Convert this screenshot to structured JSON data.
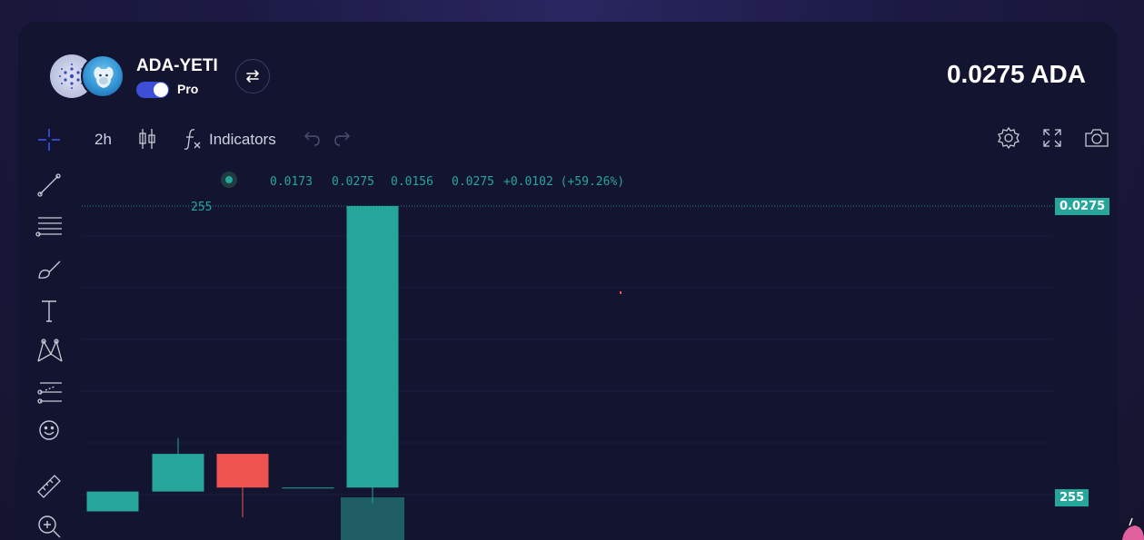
{
  "header": {
    "pair_name": "ADA-YETI",
    "pro_label": "Pro",
    "price": "0.0275 ADA"
  },
  "toolbar": {
    "interval": "2h",
    "indicators_label": "Indicators"
  },
  "legend": {
    "open": "0.0173",
    "high": "0.0275",
    "low": "0.0156",
    "close": "0.0275",
    "change": "+0.0102 (+59.26%)",
    "volume": "255"
  },
  "axis_tags": {
    "price_tag": "0.0275",
    "volume_tag": "255"
  },
  "colors": {
    "up": "#26a69a",
    "down": "#ef5350",
    "background": "#13142f"
  },
  "chart_data": {
    "type": "candlestick",
    "candles": [
      {
        "open": 0.0121,
        "close": 0.0131,
        "high": 0.0131,
        "low": 0.0121
      },
      {
        "open": 0.0131,
        "close": 0.015,
        "high": 0.0158,
        "low": 0.0131
      },
      {
        "open": 0.015,
        "close": 0.0133,
        "high": 0.015,
        "low": 0.0118
      },
      {
        "open": 0.0133,
        "close": 0.0133,
        "high": 0.0133,
        "low": 0.0133
      },
      {
        "open": 0.0133,
        "close": 0.0275,
        "high": 0.0275,
        "low": 0.0125
      }
    ],
    "ylim": [
      0.0118,
      0.0275
    ]
  }
}
